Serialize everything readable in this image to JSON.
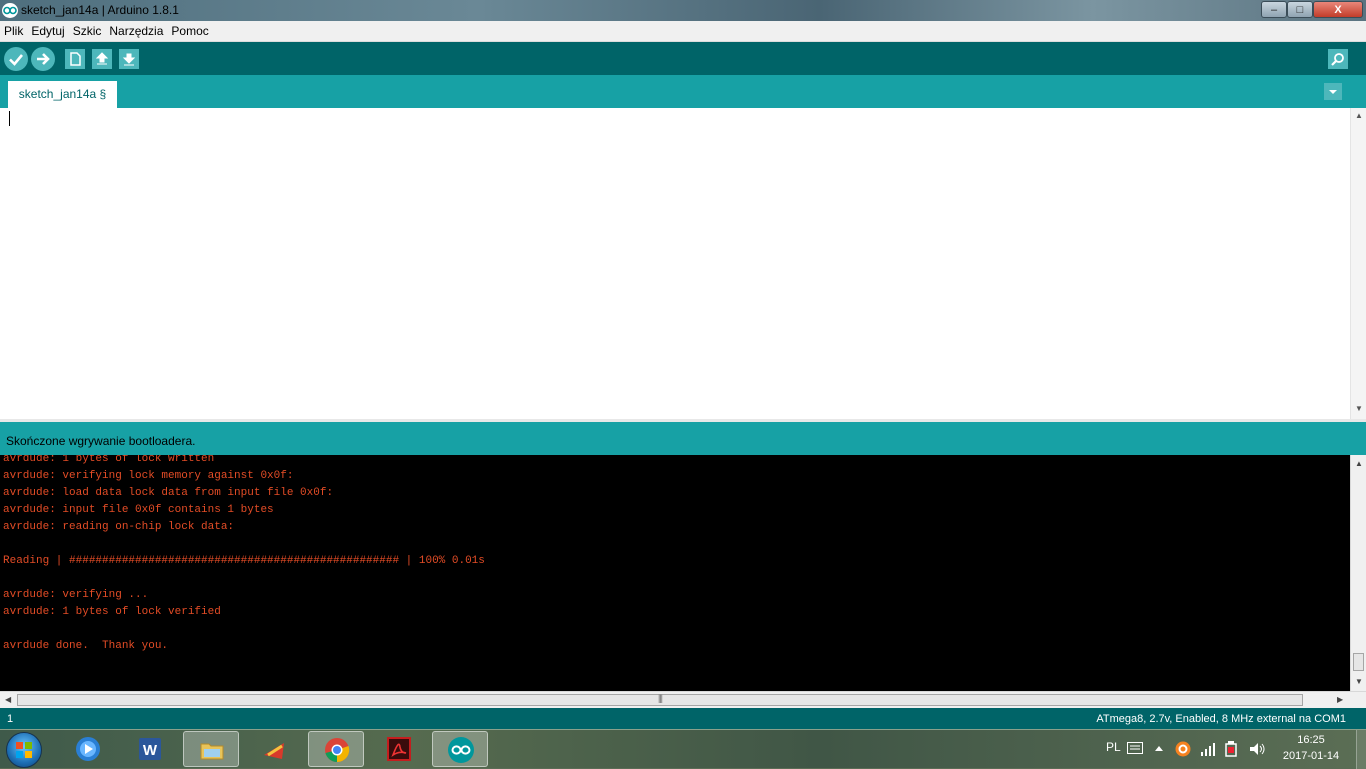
{
  "window": {
    "title": "sketch_jan14a | Arduino 1.8.1",
    "min_glyph": "–",
    "max_glyph": "□",
    "close_glyph": "X"
  },
  "menu": [
    "Plik",
    "Edytuj",
    "Szkic",
    "Narzędzia",
    "Pomoc"
  ],
  "toolbar": {
    "buttons": [
      "verify-icon",
      "upload-icon",
      "new-icon",
      "open-icon",
      "save-icon",
      "serial-monitor-icon"
    ]
  },
  "tab": {
    "label": "sketch_jan14a §"
  },
  "status": {
    "message": "Skończone wgrywanie bootloadera."
  },
  "console": {
    "lines": [
      "avrdude: 1 bytes of lock written",
      "avrdude: verifying lock memory against 0x0f:",
      "avrdude: load data lock data from input file 0x0f:",
      "avrdude: input file 0x0f contains 1 bytes",
      "avrdude: reading on-chip lock data:",
      "",
      "Reading | ################################################## | 100% 0.01s",
      "",
      "avrdude: verifying ...",
      "avrdude: 1 bytes of lock verified",
      "",
      "avrdude done.  Thank you."
    ],
    "text_color": "#e34c26"
  },
  "footer": {
    "line_number": "1",
    "board_info": "ATmega8, 2.7v, Enabled, 8 MHz external na COM1"
  },
  "colors": {
    "toolbar": "#006468",
    "tabstrip": "#17a1a5",
    "button": "#4db7bb"
  },
  "taskbar": {
    "apps": [
      "windows-media-player-icon",
      "word-icon",
      "file-explorer-icon",
      "ccleaner-icon",
      "chrome-icon",
      "acrobat-icon",
      "arduino-icon"
    ],
    "language": "PL",
    "time": "16:25",
    "date": "2017-01-14"
  }
}
